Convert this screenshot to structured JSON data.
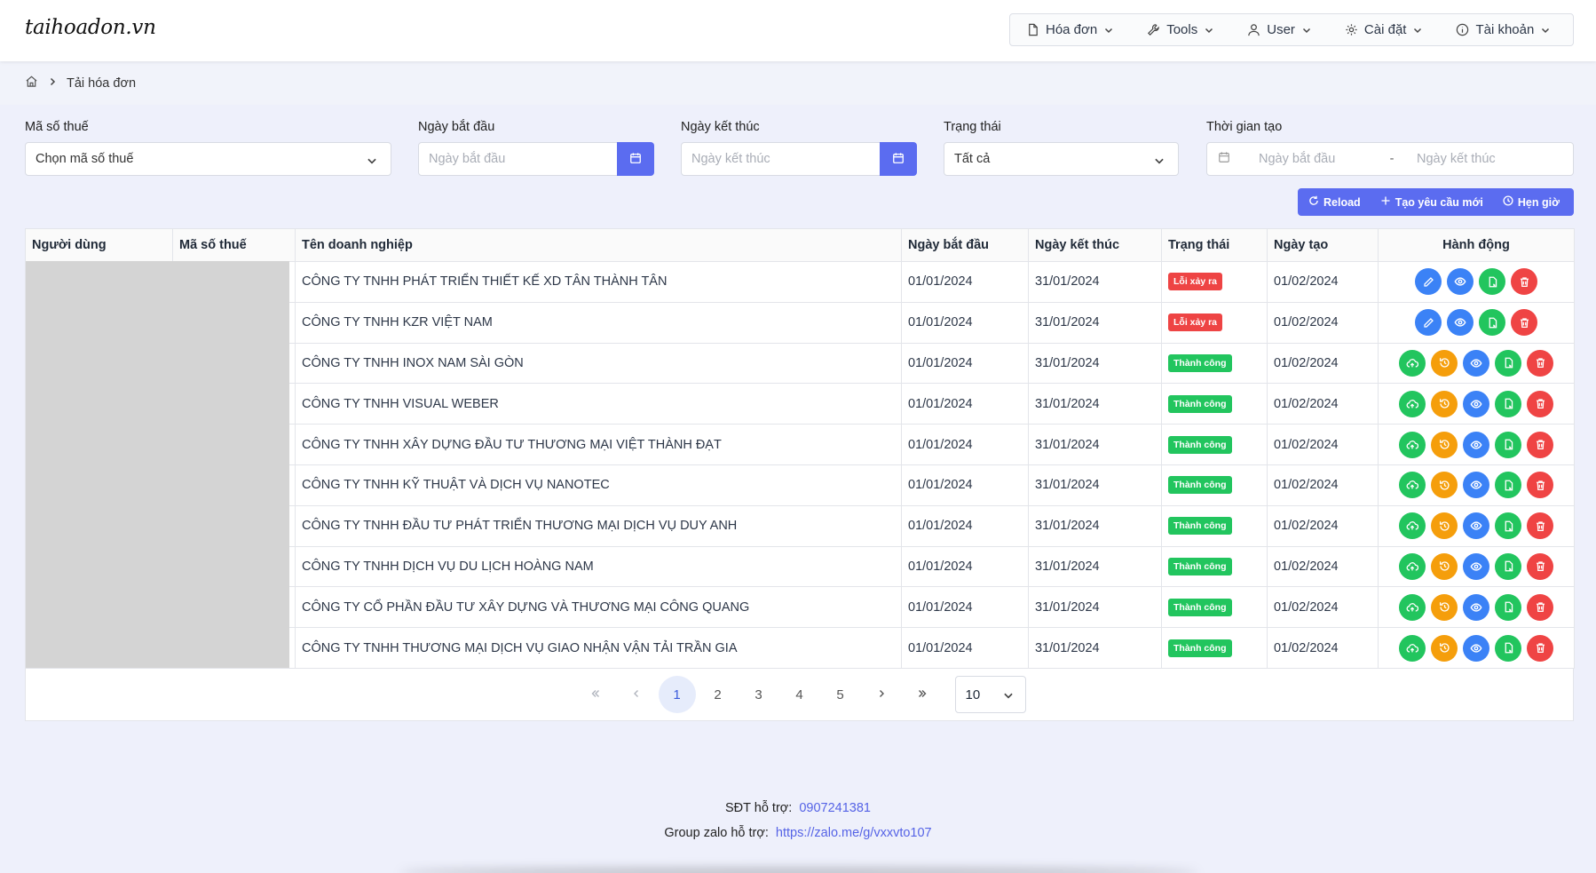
{
  "app": {
    "logo": "taihoadon.vn"
  },
  "nav": {
    "items": [
      {
        "label": "Hóa đơn",
        "icon": "document-icon"
      },
      {
        "label": "Tools",
        "icon": "wrench-icon"
      },
      {
        "label": "User",
        "icon": "user-icon"
      },
      {
        "label": "Cài đặt",
        "icon": "gear-icon"
      },
      {
        "label": "Tài khoản",
        "icon": "info-icon"
      }
    ]
  },
  "breadcrumb": {
    "current": "Tải hóa đơn"
  },
  "filters": {
    "tax_code": {
      "label": "Mã số thuế",
      "value": "Chọn mã số thuế"
    },
    "start_date": {
      "label": "Ngày bắt đầu",
      "placeholder": "Ngày bắt đầu"
    },
    "end_date": {
      "label": "Ngày kết thúc",
      "placeholder": "Ngày kết thúc"
    },
    "status": {
      "label": "Trạng thái",
      "value": "Tất cả"
    },
    "created_range": {
      "label": "Thời gian tạo",
      "start_placeholder": "Ngày bắt đầu",
      "separator": "-",
      "end_placeholder": "Ngày kết thúc"
    }
  },
  "actions": {
    "reload": "Reload",
    "new_request": "Tạo yêu cầu mới",
    "schedule": "Hẹn giờ"
  },
  "table": {
    "headers": [
      "Người dùng",
      "Mã số thuế",
      "Tên doanh nghiệp",
      "Ngày bắt đầu",
      "Ngày kết thúc",
      "Trạng thái",
      "Ngày tạo",
      "Hành động"
    ],
    "rows": [
      {
        "company": "CÔNG TY TNHH PHÁT TRIỂN THIẾT KẾ XD TÂN THÀNH TÂN",
        "start": "01/01/2024",
        "end": "31/01/2024",
        "status": "Lỗi xảy ra",
        "status_type": "error",
        "created": "01/02/2024"
      },
      {
        "company": "CÔNG TY TNHH KZR VIỆT NAM",
        "start": "01/01/2024",
        "end": "31/01/2024",
        "status": "Lỗi xảy ra",
        "status_type": "error",
        "created": "01/02/2024"
      },
      {
        "company": "CÔNG TY TNHH INOX NAM SÀI GÒN",
        "start": "01/01/2024",
        "end": "31/01/2024",
        "status": "Thành công",
        "status_type": "success",
        "created": "01/02/2024"
      },
      {
        "company": "CÔNG TY TNHH VISUAL WEBER",
        "start": "01/01/2024",
        "end": "31/01/2024",
        "status": "Thành công",
        "status_type": "success",
        "created": "01/02/2024"
      },
      {
        "company": "CÔNG TY TNHH XÂY DỰNG ĐẦU TƯ THƯƠNG MẠI VIỆT THÀNH ĐẠT",
        "start": "01/01/2024",
        "end": "31/01/2024",
        "status": "Thành công",
        "status_type": "success",
        "created": "01/02/2024"
      },
      {
        "company": "CÔNG TY TNHH KỸ THUẬT VÀ DỊCH VỤ NANOTEC",
        "start": "01/01/2024",
        "end": "31/01/2024",
        "status": "Thành công",
        "status_type": "success",
        "created": "01/02/2024"
      },
      {
        "company": "CÔNG TY TNHH ĐẦU TƯ PHÁT TRIỂN THƯƠNG MẠI DỊCH VỤ DUY ANH",
        "start": "01/01/2024",
        "end": "31/01/2024",
        "status": "Thành công",
        "status_type": "success",
        "created": "01/02/2024"
      },
      {
        "company": "CÔNG TY TNHH DỊCH VỤ DU LỊCH HOÀNG NAM",
        "start": "01/01/2024",
        "end": "31/01/2024",
        "status": "Thành công",
        "status_type": "success",
        "created": "01/02/2024"
      },
      {
        "company": "CÔNG TY CỔ PHẦN ĐẦU TƯ XÂY DỰNG VÀ THƯƠNG MẠI CÔNG QUANG",
        "start": "01/01/2024",
        "end": "31/01/2024",
        "status": "Thành công",
        "status_type": "success",
        "created": "01/02/2024"
      },
      {
        "company": "CÔNG TY TNHH THƯƠNG MẠI DỊCH VỤ GIAO NHẬN VẬN TẢI TRẦN GIA",
        "start": "01/01/2024",
        "end": "31/01/2024",
        "status": "Thành công",
        "status_type": "success",
        "created": "01/02/2024"
      }
    ]
  },
  "pagination": {
    "pages": [
      "1",
      "2",
      "3",
      "4",
      "5"
    ],
    "current": "1",
    "page_size": "10"
  },
  "footer": {
    "phone_label": "SĐT hỗ trợ:",
    "phone": "0907241381",
    "zalo_label": "Group zalo hỗ trợ:",
    "zalo_link": "https://zalo.me/g/vxxvto107"
  },
  "colors": {
    "primary": "#5b6cf0",
    "error": "#ee4444",
    "success": "#22c55e",
    "warning": "#f59e0b",
    "info": "#3b82f6"
  }
}
